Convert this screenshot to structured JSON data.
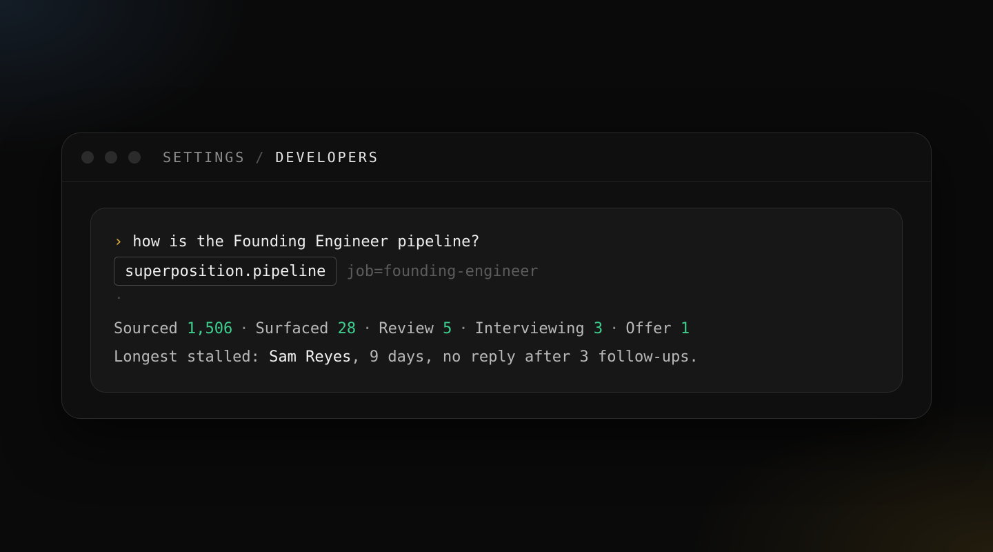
{
  "window": {
    "breadcrumb": {
      "parent": "SETTINGS",
      "separator": "/",
      "current": "DEVELOPERS"
    }
  },
  "chat": {
    "prompt_symbol": "›",
    "question": "how is the Founding Engineer pipeline?",
    "tool_call": {
      "name": "superposition.pipeline",
      "args": "job=founding-engineer"
    },
    "spinner": "·",
    "stats": [
      {
        "label": "Sourced",
        "value": "1,506"
      },
      {
        "label": "Surfaced",
        "value": "28"
      },
      {
        "label": "Review",
        "value": "5"
      },
      {
        "label": "Interviewing",
        "value": "3"
      },
      {
        "label": "Offer",
        "value": "1"
      }
    ],
    "stat_separator": "·",
    "stalled": {
      "label": "Longest stalled:",
      "name": "Sam Reyes",
      "detail": ", 9 days, no reply after 3 follow-ups."
    }
  },
  "colors": {
    "accent_green": "#3ecf8e",
    "prompt_gold": "#e2b340",
    "background": "#0a0a0a"
  }
}
